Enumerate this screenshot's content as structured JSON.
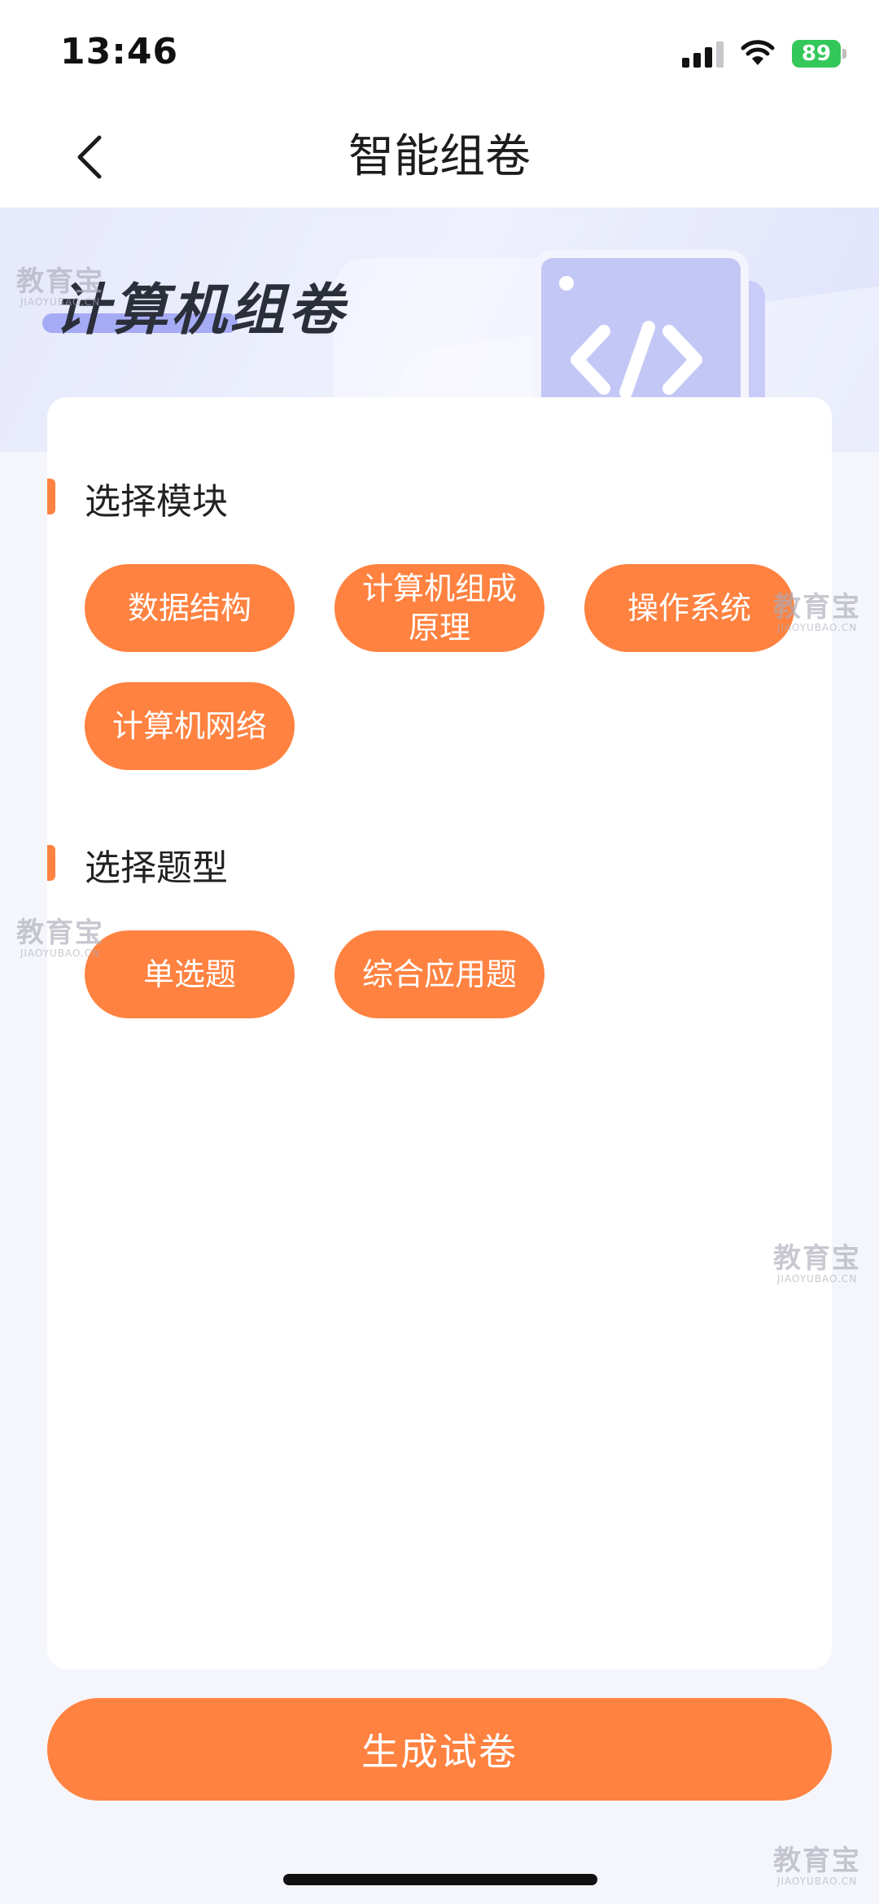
{
  "status": {
    "time": "13:46",
    "battery": "89"
  },
  "nav": {
    "title": "智能组卷"
  },
  "hero": {
    "title": "计算机组卷"
  },
  "modules": {
    "title": "选择模块",
    "items": [
      "数据结构",
      "计算机组成原理",
      "操作系统",
      "计算机网络"
    ]
  },
  "types": {
    "title": "选择题型",
    "items": [
      "单选题",
      "综合应用题"
    ]
  },
  "generate_label": "生成试卷",
  "watermark": {
    "main": "教育宝",
    "sub": "JIAOYUBAO.CN"
  },
  "colors": {
    "accent": "#ff8240",
    "hero_doc": "#c3c7f6"
  }
}
